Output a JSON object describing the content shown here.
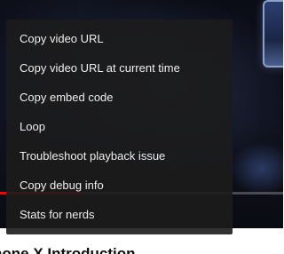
{
  "video": {
    "progress_fraction": 0.29
  },
  "context_menu": {
    "items": [
      {
        "label": "Copy video URL"
      },
      {
        "label": "Copy video URL at current time"
      },
      {
        "label": "Copy embed code"
      },
      {
        "label": "Loop"
      },
      {
        "label": "Troubleshoot playback issue"
      },
      {
        "label": "Copy debug info"
      },
      {
        "label": "Stats for nerds"
      }
    ]
  },
  "video_title": "hone X Introduction"
}
